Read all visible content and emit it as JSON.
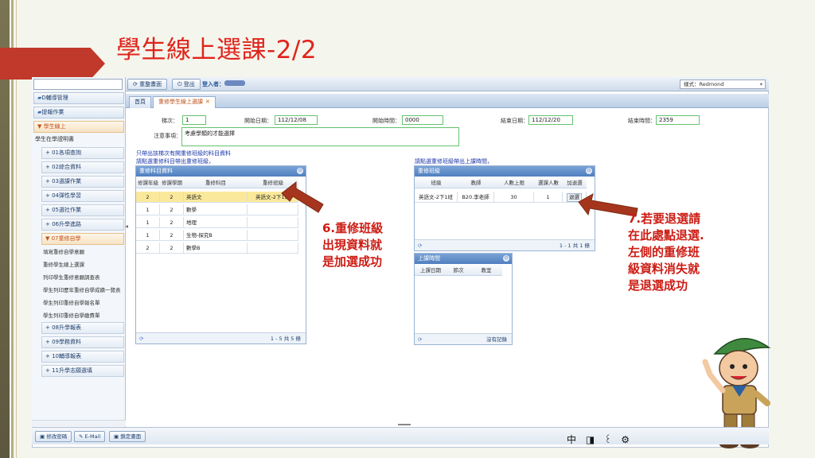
{
  "slide_title": "學生線上選課-2/2",
  "toolbar": {
    "reorganize": "重整畫面",
    "logout": "登出",
    "login_label": "登入者：",
    "style_select": "樣式：Redmond"
  },
  "sidebar": {
    "items": [
      {
        "label": "D輔導管理"
      },
      {
        "label": "提報作業"
      },
      {
        "label": "▼ 學生線上"
      },
      {
        "label": "學生在學證明書"
      },
      {
        "label": "+ 01各項查詢"
      },
      {
        "label": "+ 02綜合資料"
      },
      {
        "label": "+ 03選課作業"
      },
      {
        "label": "+ 04彈性學習"
      },
      {
        "label": "+ 05選社作業"
      },
      {
        "label": "+ 06升學進路"
      },
      {
        "label": "▼ 07重修自學"
      },
      {
        "label": "+ 08升學報表"
      },
      {
        "label": "+ 09學務資料"
      },
      {
        "label": "+ 10輔導報表"
      },
      {
        "label": "+ 11升學志願選填"
      }
    ],
    "sublinks": [
      "填寫重修自學意願",
      "重修學生線上選課",
      "列印學生重修意願調查表",
      "學生列印歷年重修自學成績一覽表",
      "學生列印重修自學報名單",
      "學生列印重修自學繳費單"
    ]
  },
  "tabs": [
    {
      "label": "首頁"
    },
    {
      "label": "重修學生線上選課"
    }
  ],
  "form": {
    "term_label": "梯次：",
    "term_value": "1",
    "start_date_label": "開始日期：",
    "start_date_value": "112/12/08",
    "start_time_label": "開始時間：",
    "start_time_value": "0000",
    "end_date_label": "結束日期：",
    "end_date_value": "112/12/20",
    "end_time_label": "結束時間：",
    "end_time_value": "2359",
    "note_label": "注意事項：",
    "note_value": "考慮學類的才能選擇",
    "hint1": "只帶出該梯次有開重修班級的科目資料",
    "hint2": "請點選重修科目帶出重修班級，",
    "hint3": "請點選重修班級帶出上課時間，"
  },
  "subject_grid": {
    "title": "重修科目資料",
    "columns": [
      "修課年級",
      "修課學期",
      "重修科目",
      "重修班級"
    ],
    "rows": [
      [
        "2",
        "2",
        "英語文",
        "英語文-2下1班"
      ],
      [
        "1",
        "2",
        "數學",
        ""
      ],
      [
        "1",
        "2",
        "地理",
        ""
      ],
      [
        "1",
        "2",
        "生物-探究B",
        ""
      ],
      [
        "2",
        "2",
        "數學B",
        ""
      ]
    ],
    "pager": "1 - 5 共 5 條"
  },
  "class_grid": {
    "title": "重修班級",
    "columns": [
      "班級",
      "教師",
      "人數上限",
      "選課人數",
      "加退選"
    ],
    "rows": [
      [
        "英語文-2下1班",
        "B20.李老師",
        "30",
        "1",
        "退選"
      ]
    ],
    "pager": "1 - 1 共 1 條"
  },
  "time_grid": {
    "title": "上課時間",
    "columns": [
      "上課日期",
      "節次",
      "教室"
    ],
    "pager": "沒有記錄"
  },
  "annotations": {
    "left": "6.重修班級\n出現資料就\n是加選成功",
    "right": "7.若要退選請\n在此處點退選.\n左側的重修班\n級資料消失就\n是退選成功"
  },
  "bottom": {
    "change_password": "修改密碼",
    "email": "E-Mail",
    "lock_screen": "鎖定畫面"
  },
  "ime": {
    "lang": "中"
  },
  "colors": {
    "title_red": "#e0241b",
    "annotation_red": "#cc1c14",
    "arrow_brown": "#a5361d",
    "header_blue": "#4f7fbf",
    "selected_row": "#fbe99b"
  }
}
